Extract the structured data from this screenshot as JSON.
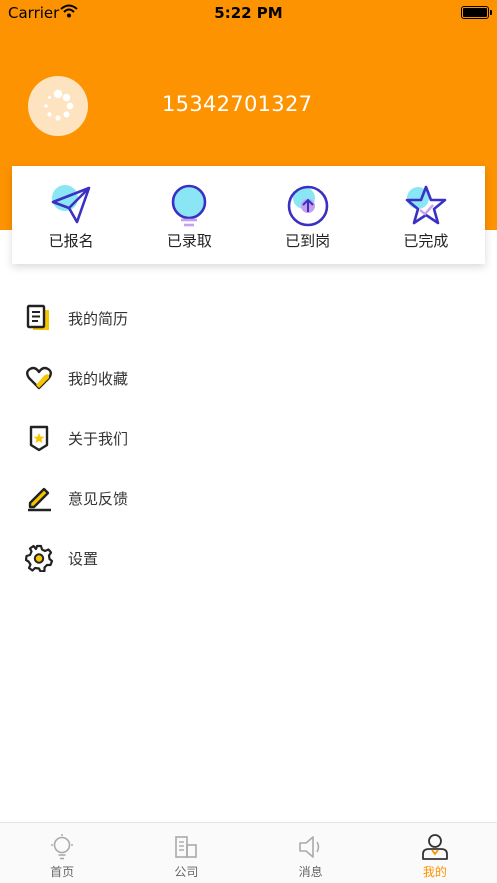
{
  "status_bar": {
    "carrier": "Carrier",
    "time": "5:22 PM"
  },
  "profile": {
    "phone": "15342701327"
  },
  "application_status": [
    {
      "label": "已报名",
      "icon": "paper-plane-icon"
    },
    {
      "label": "已录取",
      "icon": "lightbulb-icon"
    },
    {
      "label": "已到岗",
      "icon": "arrow-up-circle-icon"
    },
    {
      "label": "已完成",
      "icon": "star-icon"
    }
  ],
  "menu": [
    {
      "label": "我的简历",
      "icon": "resume-icon"
    },
    {
      "label": "我的收藏",
      "icon": "heart-icon"
    },
    {
      "label": "关于我们",
      "icon": "shield-star-icon"
    },
    {
      "label": "意见反馈",
      "icon": "pencil-icon"
    },
    {
      "label": "设置",
      "icon": "gear-icon"
    }
  ],
  "tabbar": {
    "active": "我的",
    "tabs": [
      {
        "label": "首页",
        "icon": "home-bulb-icon"
      },
      {
        "label": "公司",
        "icon": "building-icon"
      },
      {
        "label": "消息",
        "icon": "speaker-icon"
      },
      {
        "label": "我的",
        "icon": "person-icon"
      }
    ]
  },
  "colors": {
    "brand": "#fd9300",
    "accent_cyan": "#8ae6f5",
    "icon_purple": "#3b30c4"
  }
}
